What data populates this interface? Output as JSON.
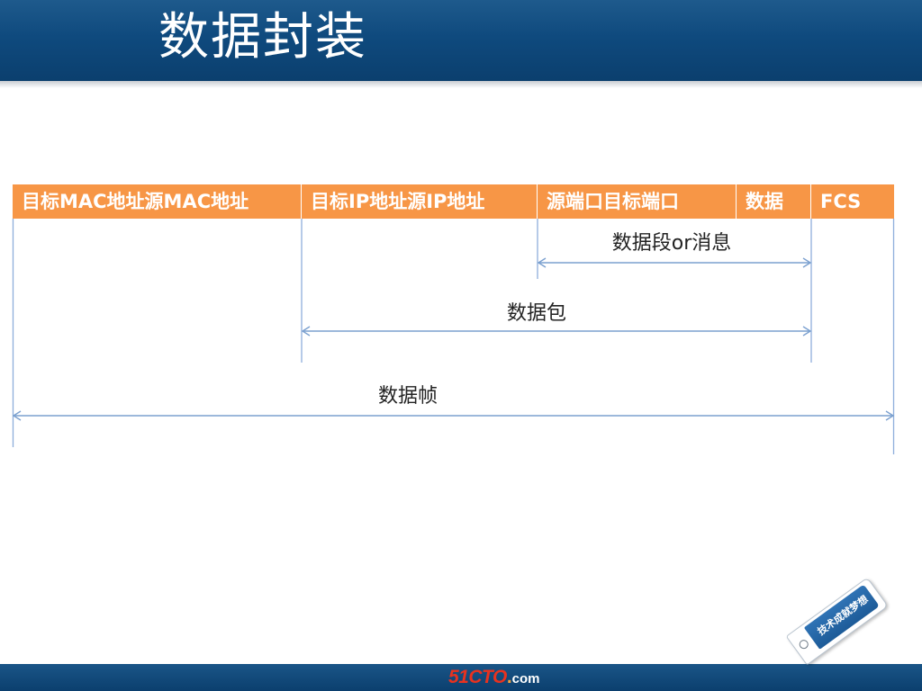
{
  "slide": {
    "title": "数据封装"
  },
  "frame": {
    "fields": [
      {
        "id": "mac",
        "label": "目标MAC地址源MAC地址"
      },
      {
        "id": "ip",
        "label": "目标IP地址源IP地址"
      },
      {
        "id": "port",
        "label": "源端口目标端口"
      },
      {
        "id": "data",
        "label": "数据"
      },
      {
        "id": "fcs",
        "label": "FCS"
      }
    ],
    "spans": [
      {
        "id": "segment",
        "label": "数据段or消息"
      },
      {
        "id": "packet",
        "label": "数据包"
      },
      {
        "id": "frame",
        "label": "数据帧"
      }
    ]
  },
  "footer": {
    "logo_main": "51CTO",
    "logo_dot": ".",
    "logo_suffix": "com"
  },
  "tag": {
    "text": "技术成就梦想"
  },
  "colors": {
    "title_bar": "#0f4a7e",
    "field_fill": "#f79646",
    "arrow_line": "#7ba0cf",
    "divider_line": "#8eaedb"
  },
  "icons": {
    "tag": "tag-icon"
  }
}
